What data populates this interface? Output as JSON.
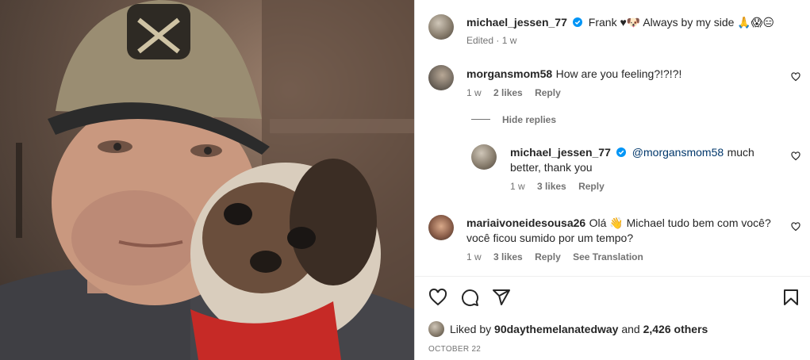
{
  "post": {
    "author": "michael_jessen_77",
    "caption_text": "Frank ♥🐶 Always by my side 🙏😱😑",
    "edited_label": "Edited",
    "edited_time": "1 w"
  },
  "comments": [
    {
      "username": "morgansmom58",
      "text": "How are you feeling?!?!?!",
      "time": "1 w",
      "likes": "2 likes",
      "reply_label": "Reply"
    },
    {
      "hide_replies_label": "Hide replies",
      "reply": {
        "username": "michael_jessen_77",
        "mention": "@morgansmom58",
        "text": "much better, thank you",
        "time": "1 w",
        "likes": "3 likes",
        "reply_label": "Reply"
      }
    },
    {
      "username": "mariaivoneidesousa26",
      "text": "Olá 👋 Michael tudo bem com você? você ficou sumido por um tempo?",
      "time": "1 w",
      "likes": "3 likes",
      "reply_label": "Reply",
      "translate_label": "See Translation"
    }
  ],
  "likes": {
    "prefix": "Liked by",
    "liker": "90daythemelanatedway",
    "and": "and",
    "others": "2,426 others"
  },
  "date": "OCTOBER 22",
  "icons": [
    "verified-icon",
    "heart-icon",
    "comment-icon",
    "share-icon",
    "bookmark-icon"
  ],
  "colors": {
    "verified": "#0095f6",
    "mention": "#00376b",
    "meta": "#737373"
  }
}
